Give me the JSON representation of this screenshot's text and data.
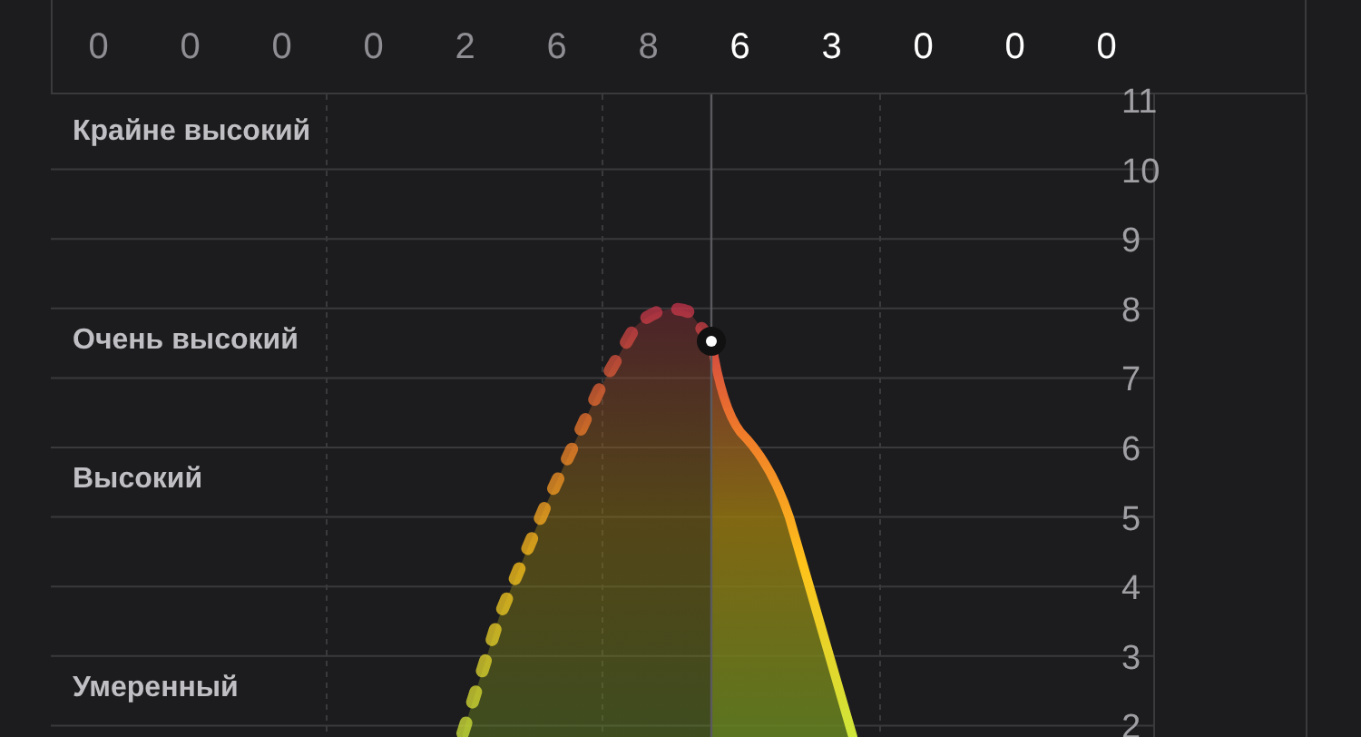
{
  "hours": [
    {
      "value": "0",
      "past": true
    },
    {
      "value": "0",
      "past": true
    },
    {
      "value": "0",
      "past": true
    },
    {
      "value": "0",
      "past": true
    },
    {
      "value": "2",
      "past": true
    },
    {
      "value": "6",
      "past": true
    },
    {
      "value": "8",
      "past": true
    },
    {
      "value": "6",
      "past": false
    },
    {
      "value": "3",
      "past": false
    },
    {
      "value": "0",
      "past": false
    },
    {
      "value": "0",
      "past": false
    },
    {
      "value": "0",
      "past": false
    }
  ],
  "y_axis": {
    "ticks": [
      "11",
      "10",
      "9",
      "8",
      "7",
      "6",
      "5",
      "4",
      "3",
      "2"
    ]
  },
  "bands": [
    {
      "label": "Крайне высокий"
    },
    {
      "label": "Очень высокий"
    },
    {
      "label": "Высокий"
    },
    {
      "label": "Умеренный"
    }
  ]
}
